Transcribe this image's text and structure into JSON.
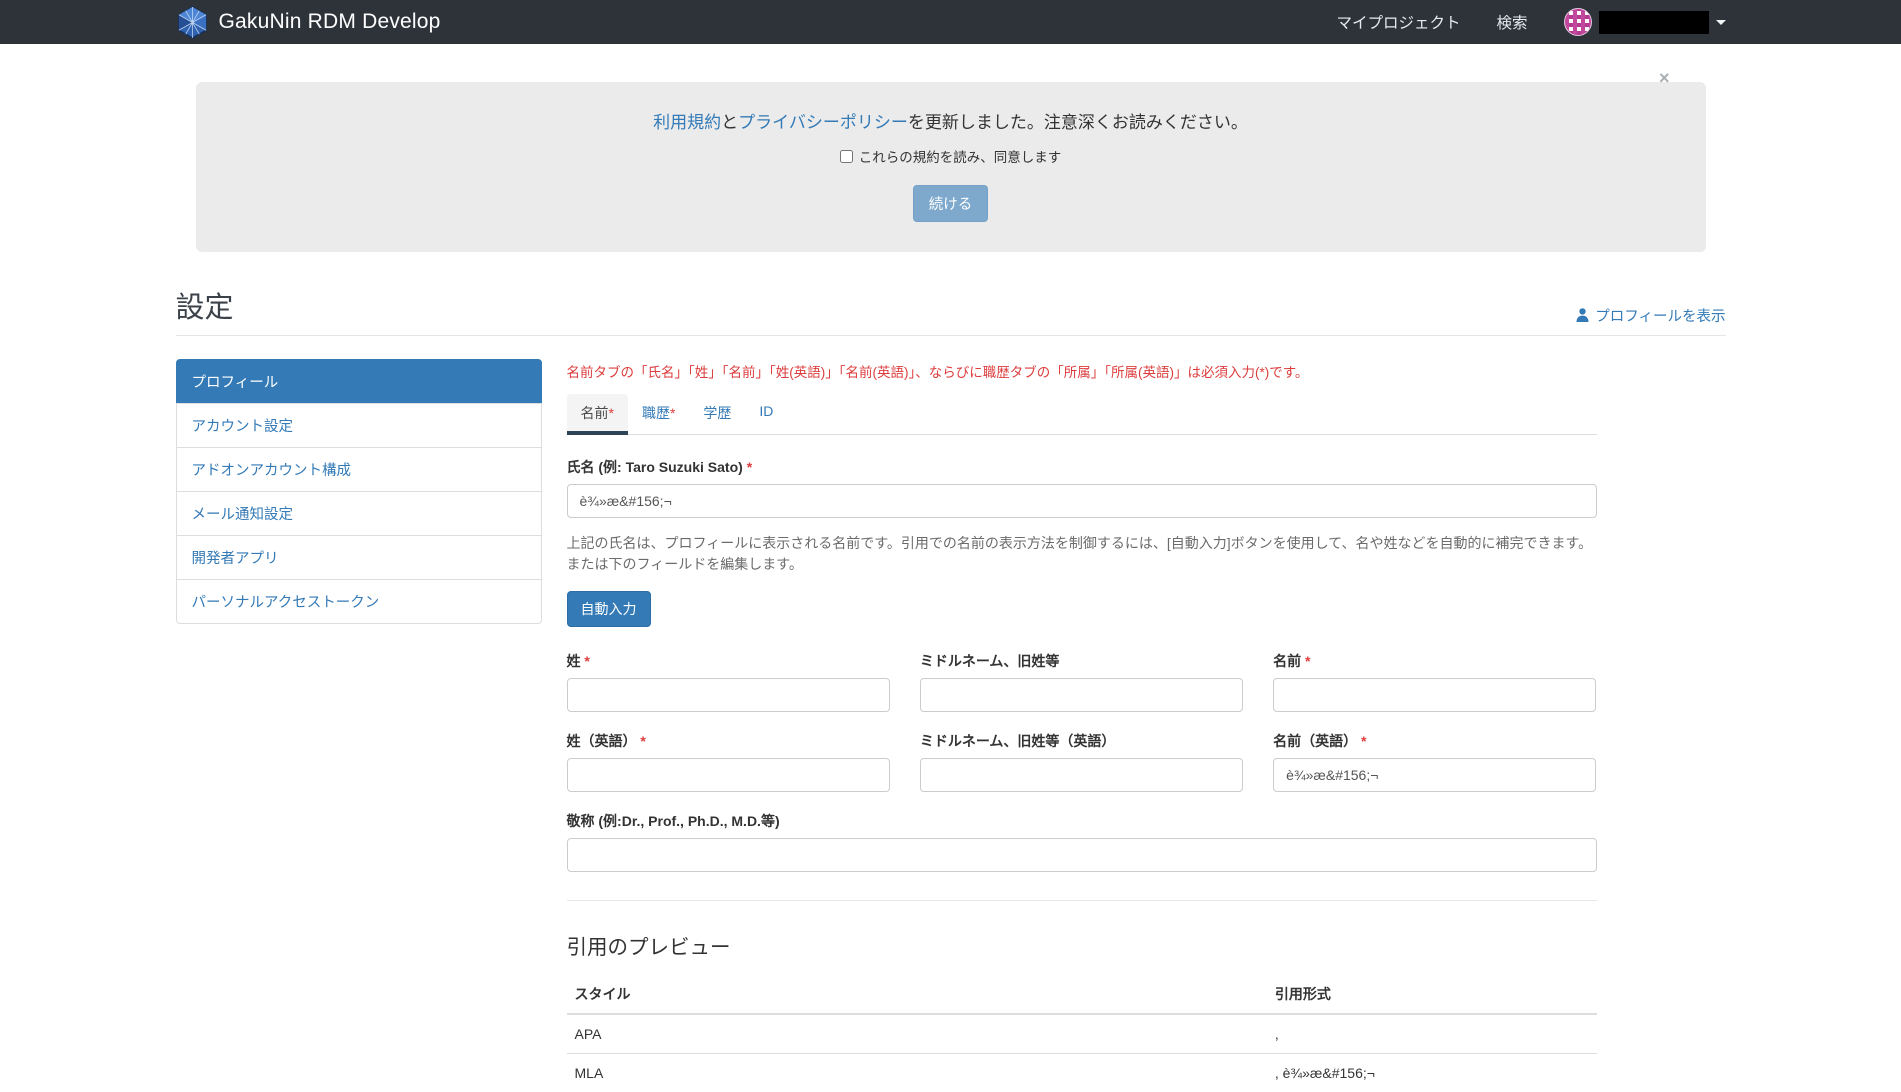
{
  "colors": {
    "accent": "#337ab7",
    "navbar_bg": "#2e333a",
    "danger": "#dc3d3d",
    "banner_bg": "#ebebeb",
    "active_tab_underline": "#2d4456"
  },
  "navbar": {
    "brand": "GakuNin RDM Develop",
    "links": [
      {
        "label": "マイプロジェクト"
      },
      {
        "label": "検索"
      }
    ]
  },
  "terms_banner": {
    "close_symbol": "×",
    "message": {
      "link_terms": "利用規約",
      "middle": "と",
      "link_privacy": "プライバシーポリシー",
      "tail": "を更新しました。注意深くお読みください。"
    },
    "checkbox_label": "これらの規約を読み、同意します",
    "checkbox_checked": false,
    "continue_button": "続ける"
  },
  "page": {
    "title": "設定",
    "view_profile_link": "プロフィールを表示"
  },
  "sidebar": {
    "items": [
      {
        "label": "プロフィール",
        "active": true
      },
      {
        "label": "アカウント設定",
        "active": false
      },
      {
        "label": "アドオンアカウント構成",
        "active": false
      },
      {
        "label": "メール通知設定",
        "active": false
      },
      {
        "label": "開発者アプリ",
        "active": false
      },
      {
        "label": "パーソナルアクセストークン",
        "active": false
      }
    ]
  },
  "profile": {
    "required_mark": "*",
    "required_note": "名前タブの「氏名」「姓」「名前」「姓(英語)」「名前(英語)」、ならびに職歴タブの「所属」「所属(英語)」は必須入力(*)です。",
    "tabs": [
      {
        "label": "名前",
        "required": true,
        "active": true
      },
      {
        "label": "職歴",
        "required": true,
        "active": false
      },
      {
        "label": "学歴",
        "required": false,
        "active": false
      },
      {
        "label": "ID",
        "required": false,
        "active": false
      }
    ],
    "name_form": {
      "full_name": {
        "label": "氏名 (例: Taro Suzuki Sato)",
        "value": "è¾»æ&#156;¬"
      },
      "help_text": "上記の氏名は、プロフィールに表示される名前です。引用での名前の表示方法を制御するには、[自動入力]ボタンを使用して、名や姓などを自動的に補完できます。または下のフィールドを編集します。",
      "autofill_button": "自動入力",
      "family_name": {
        "label": "姓",
        "value": ""
      },
      "middle_names": {
        "label": "ミドルネーム、旧姓等",
        "value": ""
      },
      "given_name": {
        "label": "名前",
        "value": ""
      },
      "family_name_en": {
        "label": "姓（英語）",
        "value": ""
      },
      "middle_names_en": {
        "label": "ミドルネーム、旧姓等（英語）",
        "value": ""
      },
      "given_name_en": {
        "label": "名前（英語）",
        "value": "è¾»æ&#156;¬"
      },
      "suffix": {
        "label": "敬称 (例:Dr., Prof., Ph.D., M.D.等)",
        "value": ""
      }
    },
    "citation_preview": {
      "title": "引用のプレビュー",
      "columns": [
        "スタイル",
        "引用形式"
      ],
      "rows": [
        {
          "style": "APA",
          "citation": ","
        },
        {
          "style": "MLA",
          "citation": ", è¾»æ&#156;¬"
        }
      ]
    }
  }
}
